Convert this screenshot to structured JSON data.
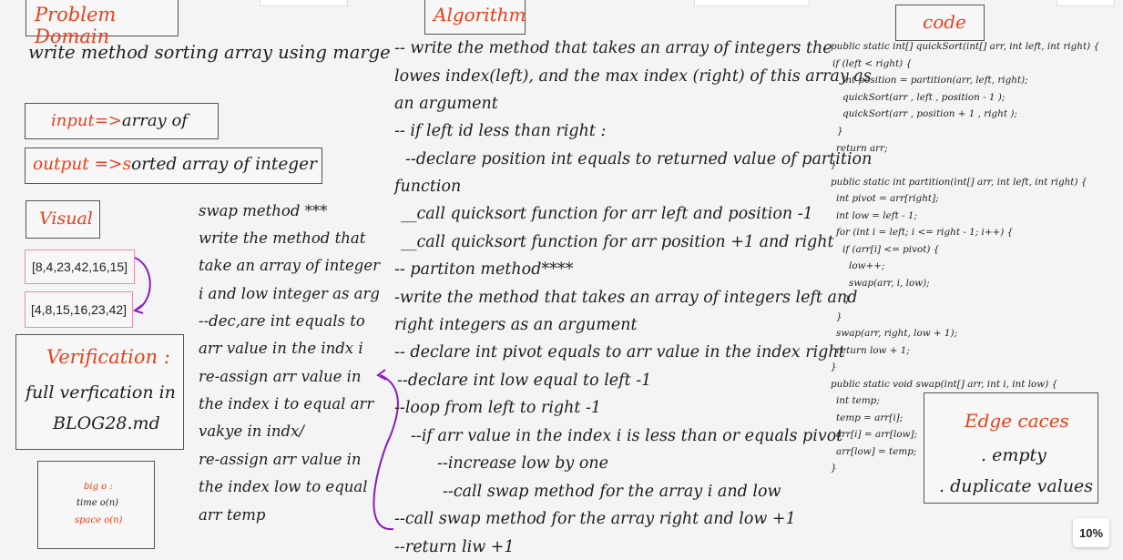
{
  "headers": {
    "problem_domain": "Problem Domain",
    "algorithm": "Algorithm",
    "code": "code",
    "visual": "Visual"
  },
  "problem": {
    "text": "write method sorting array using marge",
    "input_label": "input=>",
    "input_value": "array of",
    "output_label": "output =>",
    "output_first_letter": "s",
    "output_value": "orted array of integer"
  },
  "visual": {
    "before": "[8,4,23,42,16,15]",
    "after": "[4,8,15,16,23,42]"
  },
  "verification": {
    "title": "Verification :",
    "line1": "full verfication in",
    "line2": "BLOG28.md"
  },
  "big_o": {
    "title": "big o :",
    "time": "time o(n)",
    "space": "space o(n)"
  },
  "swap_method": [
    "swap method ***",
    "write the method that",
    "take an array of integer",
    "i and low integer as arg",
    "--dec,are int equals to",
    "arr value in the indx i",
    "re-assign arr value in",
    "the index i to equal arr",
    "vakye in indx/",
    "re-assign arr value in",
    "the index low to equal",
    "arr temp"
  ],
  "algorithm_lines": [
    "-- write the method that takes an array of integers the",
    "lowes index(left), and the max index (right) of this array as",
    "an argument",
    "-- if left id less than right :",
    "--declare position int equals to returned  value of partition",
    "function",
    "__call quicksort function for arr left and position -1",
    "__call quicksort function for arr position +1 and right",
    "-- partiton method****",
    "-write the method that takes an array of integers left and",
    "right integers as an argument",
    "-- declare int pivot equals to arr value in the index right",
    "--declare int low equal to left -1",
    "--loop from left to right -1",
    "--if arr value in the index i is less than or equals pivot",
    "--increase low by one",
    "--call swap method for the array i and low",
    "--call swap method for the array right and low +1",
    "--return liw +1"
  ],
  "code_lines": [
    "public static int[] quickSort(int[] arr, int left, int right) {",
    "if (left < right) {",
    "int position = partition(arr,  left,  right);",
    "quickSort(arr , left , position - 1 );",
    "quickSort(arr , position + 1 , right );",
    "}",
    "return arr;",
    "}",
    "public static int partition(int[] arr, int left, int right) {",
    "int pivot = arr[right];",
    "int low = left - 1;",
    "for (int i = left; i <= right - 1; i++) {",
    "if (arr[i] <= pivot) {",
    "low++;",
    "swap(arr, i, low);",
    "}",
    "}",
    "swap(arr, right, low + 1);",
    "return low + 1;",
    "}",
    "public static void swap(int[] arr, int i, int low) {",
    "int temp;",
    "temp = arr[i];",
    "arr[i] = arr[low];",
    "arr[low] = temp;",
    "}"
  ],
  "edge_cases": {
    "title": "Edge caces",
    "item1": ". empty",
    "item2": ". duplicate values"
  },
  "zoom": "10%",
  "colors": {
    "accent_red": "#e8401c",
    "arrow_purple": "#8a1cc0",
    "array_box_border": "#e58fb4"
  }
}
